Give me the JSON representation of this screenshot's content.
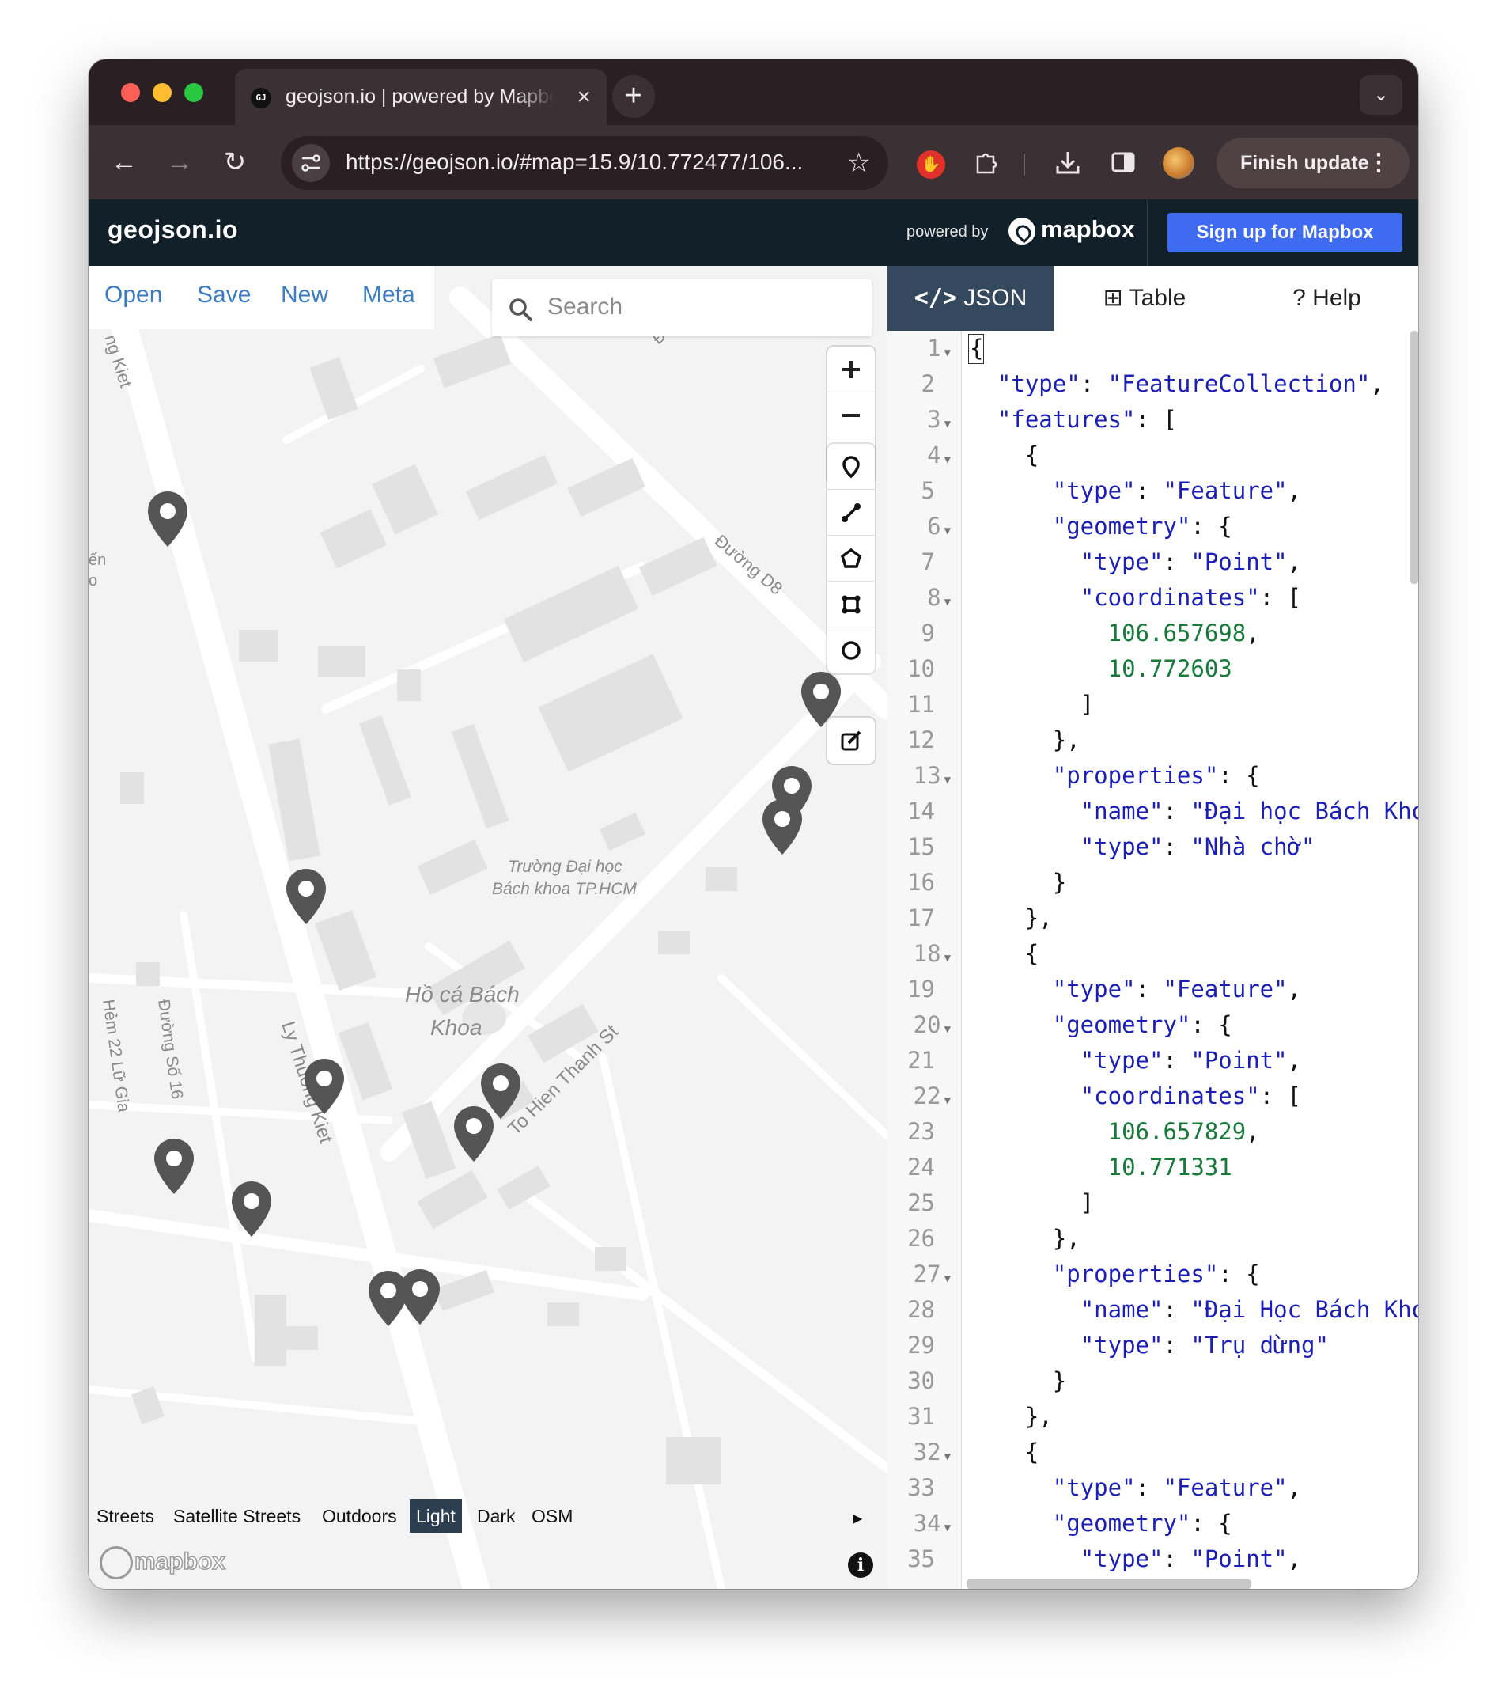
{
  "browser": {
    "tab_title": "geojson.io | powered by Mapbox",
    "tab_favicon": "GJ",
    "url": "https://geojson.io/#map=15.9/10.772477/106...",
    "finish_update": "Finish update"
  },
  "header": {
    "logo": "geojson.io",
    "powered_by": "powered by",
    "mapbox": "mapbox",
    "signup": "Sign up for Mapbox"
  },
  "menu": {
    "open": "Open",
    "save": "Save",
    "new": "New",
    "meta": "Meta"
  },
  "search": {
    "placeholder": "Search"
  },
  "map_labels": {
    "label1": "ng Kiet",
    "label2": "Đường D8",
    "label3": "Trường Đại học",
    "label4": "Bách khoa TP.HCM",
    "label5": "Hồ cá Bách",
    "label6": "Khoa",
    "label7": "Ly Thuong Kiet",
    "label8": "To Hien Thanh St",
    "label9": "Hẻm 22 Lữ Gia",
    "label10": "Đường Số 16",
    "label11": "Đường",
    "label12": "ến",
    "label13": "o"
  },
  "styles": {
    "streets": "Streets",
    "satellite": "Satellite Streets",
    "outdoors": "Outdoors",
    "light": "Light",
    "dark": "Dark",
    "osm": "OSM",
    "active": "Light"
  },
  "attribution": "mapbox",
  "panel_tabs": {
    "json": "JSON",
    "table": "Table",
    "help": "Help"
  },
  "editor_lines": [
    "{",
    "  \"type\": \"FeatureCollection\",",
    "  \"features\": [",
    "    {",
    "      \"type\": \"Feature\",",
    "      \"geometry\": {",
    "        \"type\": \"Point\",",
    "        \"coordinates\": [",
    "          106.657698,",
    "          10.772603",
    "        ]",
    "      },",
    "      \"properties\": {",
    "        \"name\": \"Đại học Bách Khoa\",",
    "        \"type\": \"Nhà chờ\"",
    "      }",
    "    },",
    "    {",
    "      \"type\": \"Feature\",",
    "      \"geometry\": {",
    "        \"type\": \"Point\",",
    "        \"coordinates\": [",
    "          106.657829,",
    "          10.771331",
    "        ]",
    "      },",
    "      \"properties\": {",
    "        \"name\": \"Đại Học Bách Khoa\",",
    "        \"type\": \"Trụ dừng\"",
    "      }",
    "    },",
    "    {",
    "      \"type\": \"Feature\",",
    "      \"geometry\": {",
    "        \"type\": \"Point\","
  ],
  "foldable_lines": [
    1,
    3,
    4,
    6,
    8,
    13,
    18,
    20,
    22,
    27,
    32,
    34
  ],
  "colors": {
    "accent": "#3f6bf0",
    "header": "#12202a",
    "marker": "#555555",
    "json_key": "#1b1fb3",
    "json_number": "#177a3a"
  }
}
